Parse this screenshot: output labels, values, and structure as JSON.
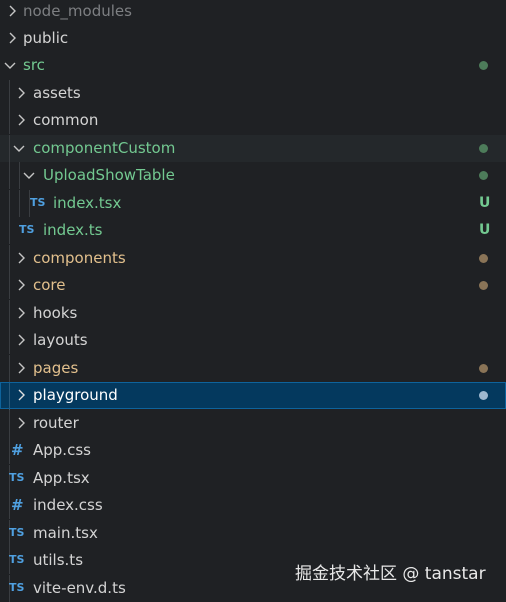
{
  "colors": {
    "background": "#1f2124",
    "selected_background": "#04395e",
    "selected_border": "#0e639c",
    "untracked_green": "#73c991",
    "modified_tan": "#e2c08d",
    "ignored_gray": "#7d7f82",
    "typescript_blue": "#4fa0e0",
    "dot_green": "#4d7c5a",
    "dot_brown": "#8a7457",
    "dot_selected": "#9fb8cf"
  },
  "tree": [
    {
      "label": "node_modules",
      "kind": "folder",
      "state": "collapsed",
      "color": "ignored"
    },
    {
      "label": "public",
      "kind": "folder",
      "state": "collapsed",
      "color": "default"
    },
    {
      "label": "src",
      "kind": "folder",
      "state": "expanded",
      "color": "green",
      "decoration": "dot"
    },
    {
      "label": "assets",
      "kind": "folder",
      "state": "collapsed",
      "color": "default"
    },
    {
      "label": "common",
      "kind": "folder",
      "state": "collapsed",
      "color": "default"
    },
    {
      "label": "componentCustom",
      "kind": "folder",
      "state": "expanded",
      "color": "green",
      "decoration": "dot"
    },
    {
      "label": "UploadShowTable",
      "kind": "folder",
      "state": "expanded",
      "color": "green",
      "decoration": "dot"
    },
    {
      "label": "index.tsx",
      "kind": "file",
      "icon_text": "TS",
      "color": "green",
      "decoration": "U"
    },
    {
      "label": "index.ts",
      "kind": "file",
      "icon_text": "TS",
      "color": "green",
      "decoration": "U"
    },
    {
      "label": "components",
      "kind": "folder",
      "state": "collapsed",
      "color": "modified",
      "decoration": "dot"
    },
    {
      "label": "core",
      "kind": "folder",
      "state": "collapsed",
      "color": "modified",
      "decoration": "dot"
    },
    {
      "label": "hooks",
      "kind": "folder",
      "state": "collapsed",
      "color": "default"
    },
    {
      "label": "layouts",
      "kind": "folder",
      "state": "collapsed",
      "color": "default"
    },
    {
      "label": "pages",
      "kind": "folder",
      "state": "collapsed",
      "color": "modified",
      "decoration": "dot"
    },
    {
      "label": "playground",
      "kind": "folder",
      "state": "collapsed",
      "color": "selected",
      "decoration": "dot",
      "selected": true
    },
    {
      "label": "router",
      "kind": "folder",
      "state": "collapsed",
      "color": "default"
    },
    {
      "label": "App.css",
      "kind": "file",
      "icon_text": "#",
      "color": "default"
    },
    {
      "label": "App.tsx",
      "kind": "file",
      "icon_text": "TS",
      "color": "default"
    },
    {
      "label": "index.css",
      "kind": "file",
      "icon_text": "#",
      "color": "default"
    },
    {
      "label": "main.tsx",
      "kind": "file",
      "icon_text": "TS",
      "color": "default"
    },
    {
      "label": "utils.ts",
      "kind": "file",
      "icon_text": "TS",
      "color": "default"
    },
    {
      "label": "vite-env.d.ts",
      "kind": "file",
      "icon_text": "TS",
      "color": "default"
    }
  ],
  "watermark": "掘金技术社区 @ tanstar"
}
